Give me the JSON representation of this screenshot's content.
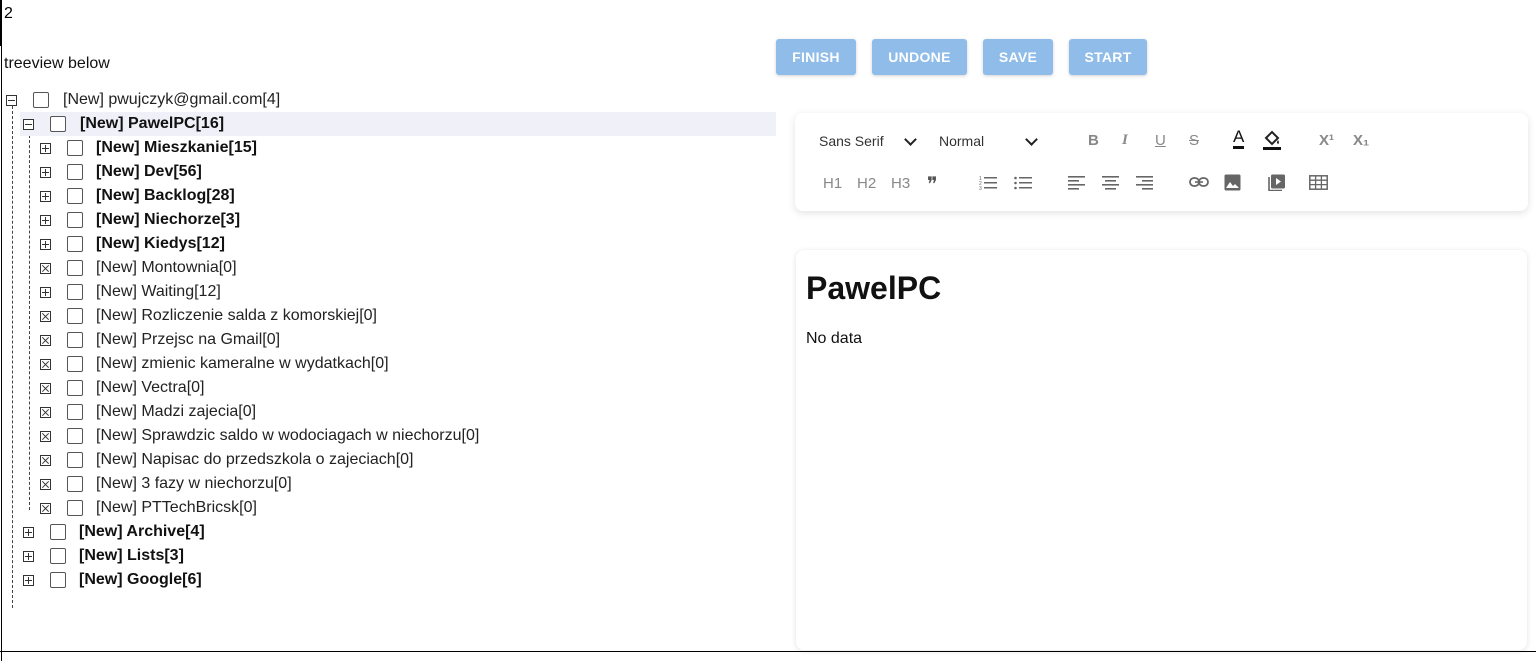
{
  "counter": "2",
  "treeview_caption": "treeview below",
  "tree": {
    "root": "[New] pwujczyk@gmail.com[4]",
    "selected": "[New] PawelPC[16]",
    "children": [
      "[New] Mieszkanie[15]",
      "[New] Dev[56]",
      "[New] Backlog[28]",
      "[New] Niechorze[3]",
      "[New] Kiedys[12]",
      "[New] Montownia[0]",
      "[New] Waiting[12]",
      "[New] Rozliczenie salda z komorskiej[0]",
      "[New] Przejsc na Gmail[0]",
      "[New] zmienic kameralne w wydatkach[0]",
      "[New] Vectra[0]",
      "[New] Madzi zajecia[0]",
      "[New] Sprawdzic saldo w wodociagach w niechorzu[0]",
      "[New] Napisac do przedszkola o zajeciach[0]",
      "[New] 3 fazy w niechorzu[0]",
      "[New] PTTechBricsk[0]"
    ],
    "siblings": [
      "[New] Archive[4]",
      "[New] Lists[3]",
      "[New] Google[6]"
    ]
  },
  "buttons": {
    "finish": "FINISH",
    "undone": "UNDONE",
    "save": "SAVE",
    "start": "START"
  },
  "toolbar": {
    "font": "Sans Serif",
    "size": "Normal",
    "bold": "B",
    "italic": "I",
    "underline": "U",
    "strike": "S",
    "text_color": "A",
    "superscript": "X¹",
    "subscript": "X₁",
    "h1": "H1",
    "h2": "H2",
    "h3": "H3",
    "quote": "❞"
  },
  "editor": {
    "title": "PawelPC",
    "body": "No data"
  },
  "colors": {
    "button_bg": "#8fbce9",
    "selected_row_bg": "#f0f0f8"
  }
}
